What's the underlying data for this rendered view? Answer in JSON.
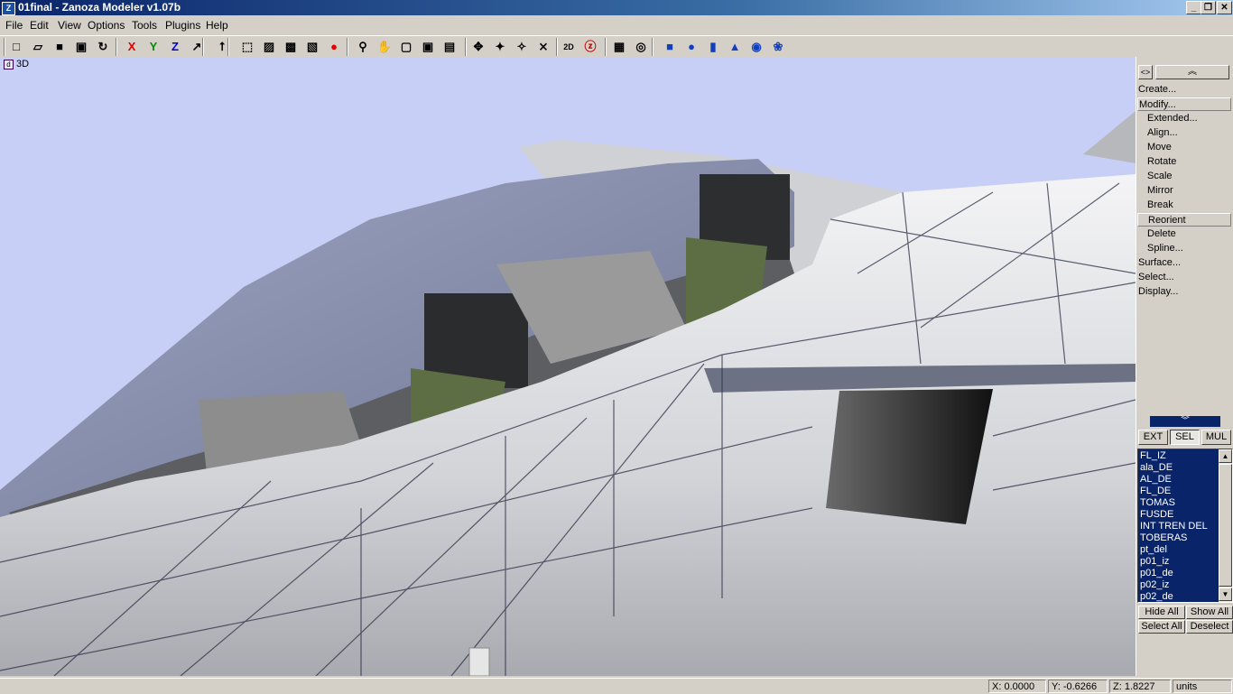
{
  "window": {
    "title": "01final - Zanoza Modeler v1.07b",
    "icon_text": "Z",
    "minimize": "_",
    "maximize": "❐",
    "close": "✕"
  },
  "menu": [
    "File",
    "Edit",
    "View",
    "Options",
    "Tools",
    "Plugins",
    "Help"
  ],
  "toolbar": [
    {
      "name": "new-icon",
      "glyph": "□"
    },
    {
      "name": "open-icon",
      "glyph": "▱"
    },
    {
      "name": "save-icon",
      "glyph": "■"
    },
    {
      "name": "save-as-icon",
      "glyph": "▣"
    },
    {
      "name": "export-icon",
      "glyph": "↻"
    },
    {
      "name": "x-axis-icon",
      "glyph": "X",
      "color": "#e00000"
    },
    {
      "name": "y-axis-icon",
      "glyph": "Y",
      "color": "#009000"
    },
    {
      "name": "z-axis-icon",
      "glyph": "Z",
      "color": "#0000d0"
    },
    {
      "name": "axis-cursor-icon",
      "glyph": "↗"
    },
    {
      "name": "vertex-select-icon",
      "glyph": "⭡"
    },
    {
      "name": "cube-select-icon",
      "glyph": "⬚"
    },
    {
      "name": "cube-edge-icon",
      "glyph": "▨"
    },
    {
      "name": "cube-face-icon",
      "glyph": "▩"
    },
    {
      "name": "cube-object-icon",
      "glyph": "▧"
    },
    {
      "name": "render-sphere-icon",
      "glyph": "●",
      "color": "#e00000"
    },
    {
      "name": "zoom-icon",
      "glyph": "⚲"
    },
    {
      "name": "pan-hand-icon",
      "glyph": "✋"
    },
    {
      "name": "box-view-icon",
      "glyph": "▢"
    },
    {
      "name": "zoom-region-icon",
      "glyph": "▣"
    },
    {
      "name": "camera-icon",
      "glyph": "▤"
    },
    {
      "name": "move-vertex-icon",
      "glyph": "✥"
    },
    {
      "name": "scale-vertex-icon",
      "glyph": "✦"
    },
    {
      "name": "rotate-vertex-icon",
      "glyph": "✧"
    },
    {
      "name": "axes-gizmo-icon",
      "glyph": "⨯"
    },
    {
      "name": "view-2d3d-icon",
      "glyph": "2D"
    },
    {
      "name": "z-mode-icon",
      "glyph": "ⓩ",
      "color": "#c00000"
    },
    {
      "name": "grid-snap-icon",
      "glyph": "▦"
    },
    {
      "name": "center-snap-icon",
      "glyph": "◎"
    },
    {
      "name": "create-box-icon",
      "glyph": "■",
      "color": "#1040c0"
    },
    {
      "name": "create-sphere-icon",
      "glyph": "●",
      "color": "#1040c0"
    },
    {
      "name": "create-cylinder-icon",
      "glyph": "▮",
      "color": "#1040c0"
    },
    {
      "name": "create-cone-icon",
      "glyph": "▲",
      "color": "#1040c0"
    },
    {
      "name": "create-torus-icon",
      "glyph": "◉",
      "color": "#1040c0"
    },
    {
      "name": "create-gear-icon",
      "glyph": "❀",
      "color": "#1040c0"
    }
  ],
  "viewport": {
    "label": "3D",
    "icon": "d"
  },
  "panel": {
    "mini_btn": "<>",
    "scroll_up": "︽",
    "scroll_down": "︾",
    "commands": [
      {
        "label": "Create...",
        "level": "top"
      },
      {
        "label": "Modify...",
        "level": "top",
        "highlighted": true
      },
      {
        "label": "Extended...",
        "level": "sub"
      },
      {
        "label": "Align...",
        "level": "sub"
      },
      {
        "label": "Move",
        "level": "sub"
      },
      {
        "label": "Rotate",
        "level": "sub"
      },
      {
        "label": "Scale",
        "level": "sub"
      },
      {
        "label": "Mirror",
        "level": "sub"
      },
      {
        "label": "Break",
        "level": "sub"
      },
      {
        "label": "Reorient",
        "level": "sub",
        "highlighted": true
      },
      {
        "label": "Delete",
        "level": "sub"
      },
      {
        "label": "Spline...",
        "level": "sub"
      },
      {
        "label": "Surface...",
        "level": "top"
      },
      {
        "label": "Select...",
        "level": "top"
      },
      {
        "label": "Display...",
        "level": "top"
      }
    ],
    "tabs": [
      {
        "label": "EXT",
        "active": false
      },
      {
        "label": "SEL",
        "active": true
      },
      {
        "label": "MUL",
        "active": false
      }
    ],
    "objects": [
      "FL_IZ",
      "ala_DE",
      "AL_DE",
      "FL_DE",
      "TOMAS",
      "FUSDE",
      "INT TREN DEL",
      "TOBERAS",
      "pt_del",
      "p01_iz",
      "p01_de",
      "p02_iz",
      "p02_de"
    ],
    "buttons": {
      "hide_all": "Hide All",
      "show_all": "Show All",
      "select_all": "Select All",
      "deselect": "Deselect"
    }
  },
  "status": {
    "x": "X: 0.0000",
    "y": "Y: -0.6266",
    "z": "Z: 1.8227",
    "units": "units"
  }
}
